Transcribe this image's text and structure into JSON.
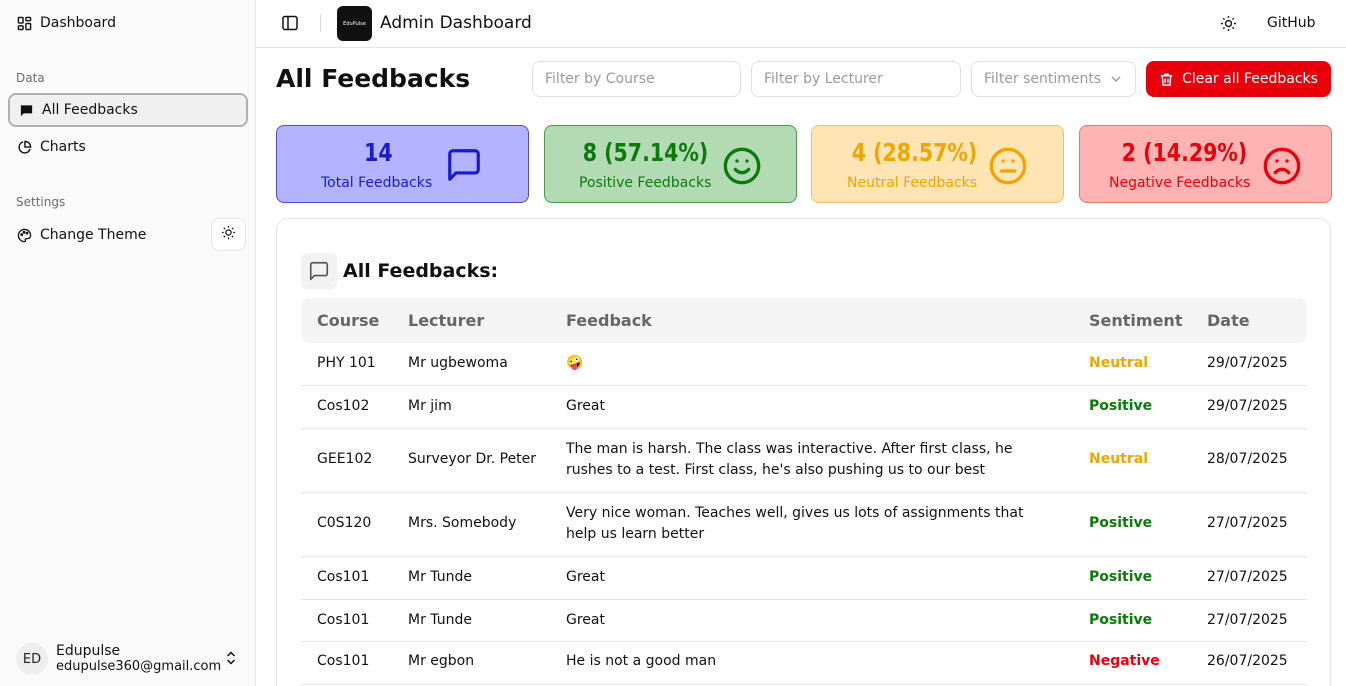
{
  "sidebar": {
    "dashboard_label": "Dashboard",
    "group_data": "Data",
    "all_feedbacks_label": "All Feedbacks",
    "charts_label": "Charts",
    "group_settings": "Settings",
    "change_theme_label": "Change Theme",
    "user": {
      "initials": "ED",
      "name": "Edupulse",
      "email": "edupulse360@gmail.com"
    }
  },
  "header": {
    "logo_text": "EduPulse",
    "title": "Admin Dashboard",
    "github_label": "GitHub"
  },
  "page": {
    "title": "All Feedbacks",
    "filter_course_placeholder": "Filter by Course",
    "filter_lecturer_placeholder": "Filter by Lecturer",
    "filter_sentiment_placeholder": "Filter sentiments",
    "clear_button_label": "Clear all Feedbacks"
  },
  "stats": {
    "total": {
      "value": "14",
      "label": "Total Feedbacks"
    },
    "positive": {
      "value": "8 (57.14%)",
      "label": "Positive Feedbacks"
    },
    "neutral": {
      "value": "4 (28.57%)",
      "label": "Neutral Feedbacks"
    },
    "negative": {
      "value": "2 (14.29%)",
      "label": "Negative Feedbacks"
    }
  },
  "table": {
    "title": "All Feedbacks:",
    "headers": [
      "Course",
      "Lecturer",
      "Feedback",
      "Sentiment",
      "Date"
    ],
    "rows": [
      {
        "course": "PHY 101",
        "lecturer": "Mr ugbewoma",
        "feedback": "🤪",
        "sentiment": "Neutral",
        "date": "29/07/2025"
      },
      {
        "course": "Cos102",
        "lecturer": "Mr jim",
        "feedback": "Great",
        "sentiment": "Positive",
        "date": "29/07/2025"
      },
      {
        "course": "GEE102",
        "lecturer": "Surveyor Dr. Peter",
        "feedback": "The man is harsh. The class was interactive. After first class, he rushes to a test. First class, he's also pushing us to our best",
        "sentiment": "Neutral",
        "date": "28/07/2025"
      },
      {
        "course": "C0S120",
        "lecturer": "Mrs. Somebody",
        "feedback": "Very nice woman. Teaches well, gives us lots of assignments that help us learn better",
        "sentiment": "Positive",
        "date": "27/07/2025"
      },
      {
        "course": "Cos101",
        "lecturer": "Mr Tunde",
        "feedback": "Great",
        "sentiment": "Positive",
        "date": "27/07/2025"
      },
      {
        "course": "Cos101",
        "lecturer": "Mr Tunde",
        "feedback": "Great",
        "sentiment": "Positive",
        "date": "27/07/2025"
      },
      {
        "course": "Cos101",
        "lecturer": "Mr egbon",
        "feedback": "He is not a good man",
        "sentiment": "Negative",
        "date": "26/07/2025"
      }
    ]
  },
  "colors": {
    "positive": "#0a7a0a",
    "neutral": "#f0a500",
    "negative": "#e8000b",
    "total_text": "#1a1acc",
    "clear_button": "#e8000b"
  }
}
